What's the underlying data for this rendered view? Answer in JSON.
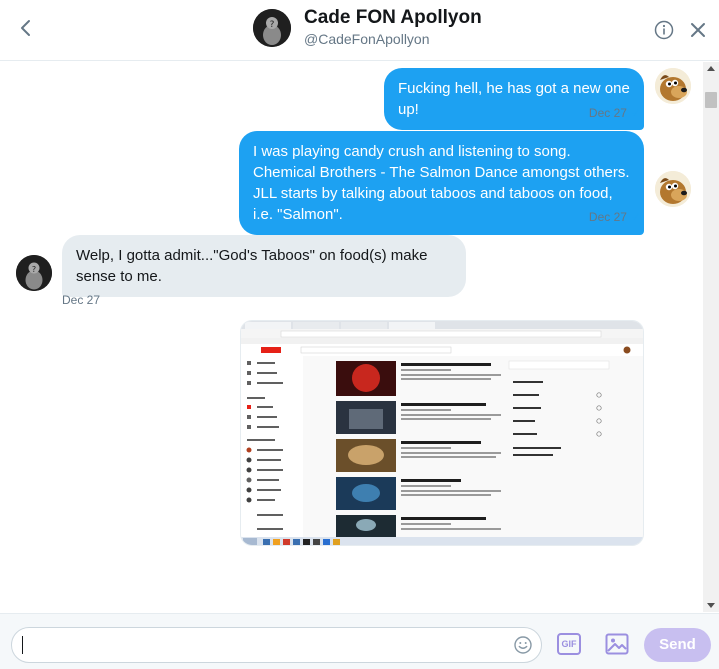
{
  "header": {
    "name": "Cade FON Apollyon",
    "handle": "@CadeFonApollyon"
  },
  "messages": [
    {
      "direction": "out",
      "text": "Fucking hell, he has got a new one up!",
      "time": "Dec 27",
      "status": "✓"
    },
    {
      "direction": "out",
      "text": "I was playing candy crush and listening to song. Chemical Brothers - The Salmon Dance amongst others. JLL starts by talking about taboos and taboos on food, i.e. \"Salmon\".",
      "time": "Dec 27",
      "status": "✓"
    },
    {
      "direction": "in",
      "text": "Welp, I gotta admit...\"God's Taboos\" on food(s) make sense to me.",
      "time": "Dec 27"
    }
  ],
  "screenshot": {
    "video_titles": [
      "Diamond Sow: Power at the End of Pretending",
      "Gorillaz - Saturnz Barz (Spirit House)",
      "Gorillaz - Dirty Harry (Official Video)",
      "Gorillaz - DARE (Official Video)",
      "The Chemical Brothers - The Salmon Dance"
    ],
    "side_menu": [
      "Home",
      "Trending",
      "Subscriptions",
      "LIBRARY",
      "History",
      "Watch later",
      "Liked videos"
    ],
    "history_panel": [
      "Watch history",
      "Search history",
      "Comments",
      "Community"
    ]
  },
  "composer": {
    "placeholder": "",
    "gif_label": "GIF",
    "send_label": "Send"
  },
  "colors": {
    "outgoing_bubble": "#1da1f2",
    "incoming_bubble": "#e6ecf0",
    "send_disabled": "#c8bff0",
    "accent_purple": "#9b8fe0"
  }
}
